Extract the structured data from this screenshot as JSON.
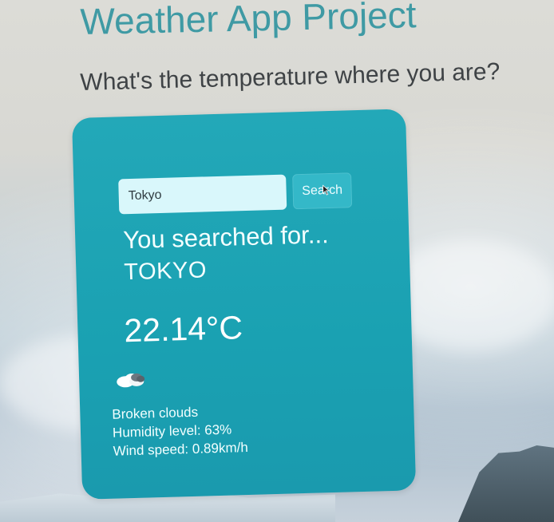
{
  "header": {
    "title": "Weather App Project",
    "subtitle": "What's the temperature where you are?"
  },
  "search": {
    "value": "Tokyo",
    "placeholder": "",
    "button_label": "Search"
  },
  "result": {
    "searched_label": "You searched for...",
    "city": "TOKYO",
    "temperature": "22.14°C",
    "condition": "Broken clouds",
    "humidity": "Humidity level: 63%",
    "wind": "Wind speed: 0.89km/h",
    "icon": "cloud-icon"
  },
  "colors": {
    "title": "#3f9aa4",
    "card": "#1fa5b6",
    "button": "#34b8c8",
    "input": "#d9f7fb"
  }
}
